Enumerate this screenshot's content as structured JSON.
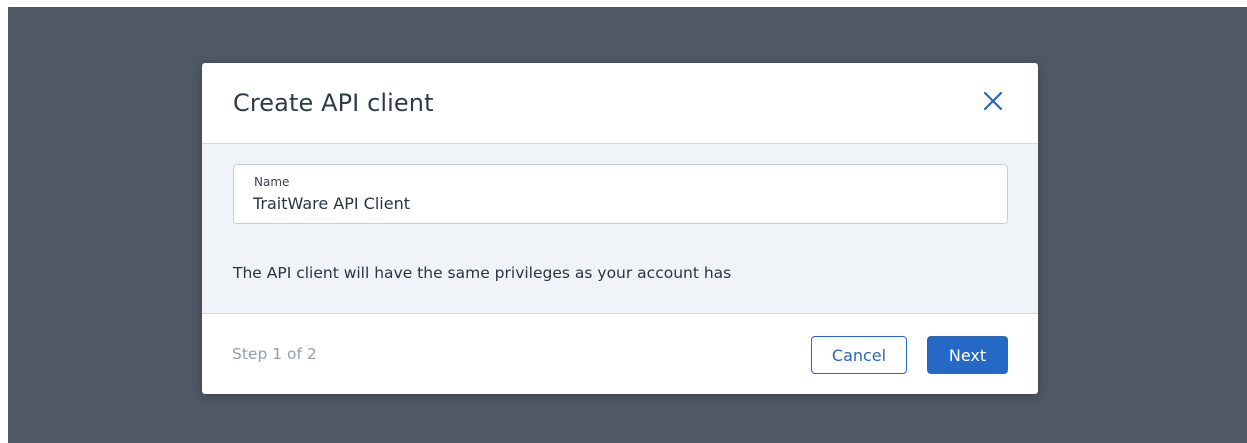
{
  "dialog": {
    "title": "Create API client",
    "close_icon": "close-icon"
  },
  "form": {
    "name_label": "Name",
    "name_value": "TraitWare API Client",
    "info_text": "The API client will have the same privileges as your account has"
  },
  "footer": {
    "step_text": "Step 1 of 2",
    "cancel_label": "Cancel",
    "next_label": "Next"
  },
  "colors": {
    "overlay": "#4f5866",
    "accent": "#2668c5",
    "body_bg": "#f0f4f8"
  }
}
